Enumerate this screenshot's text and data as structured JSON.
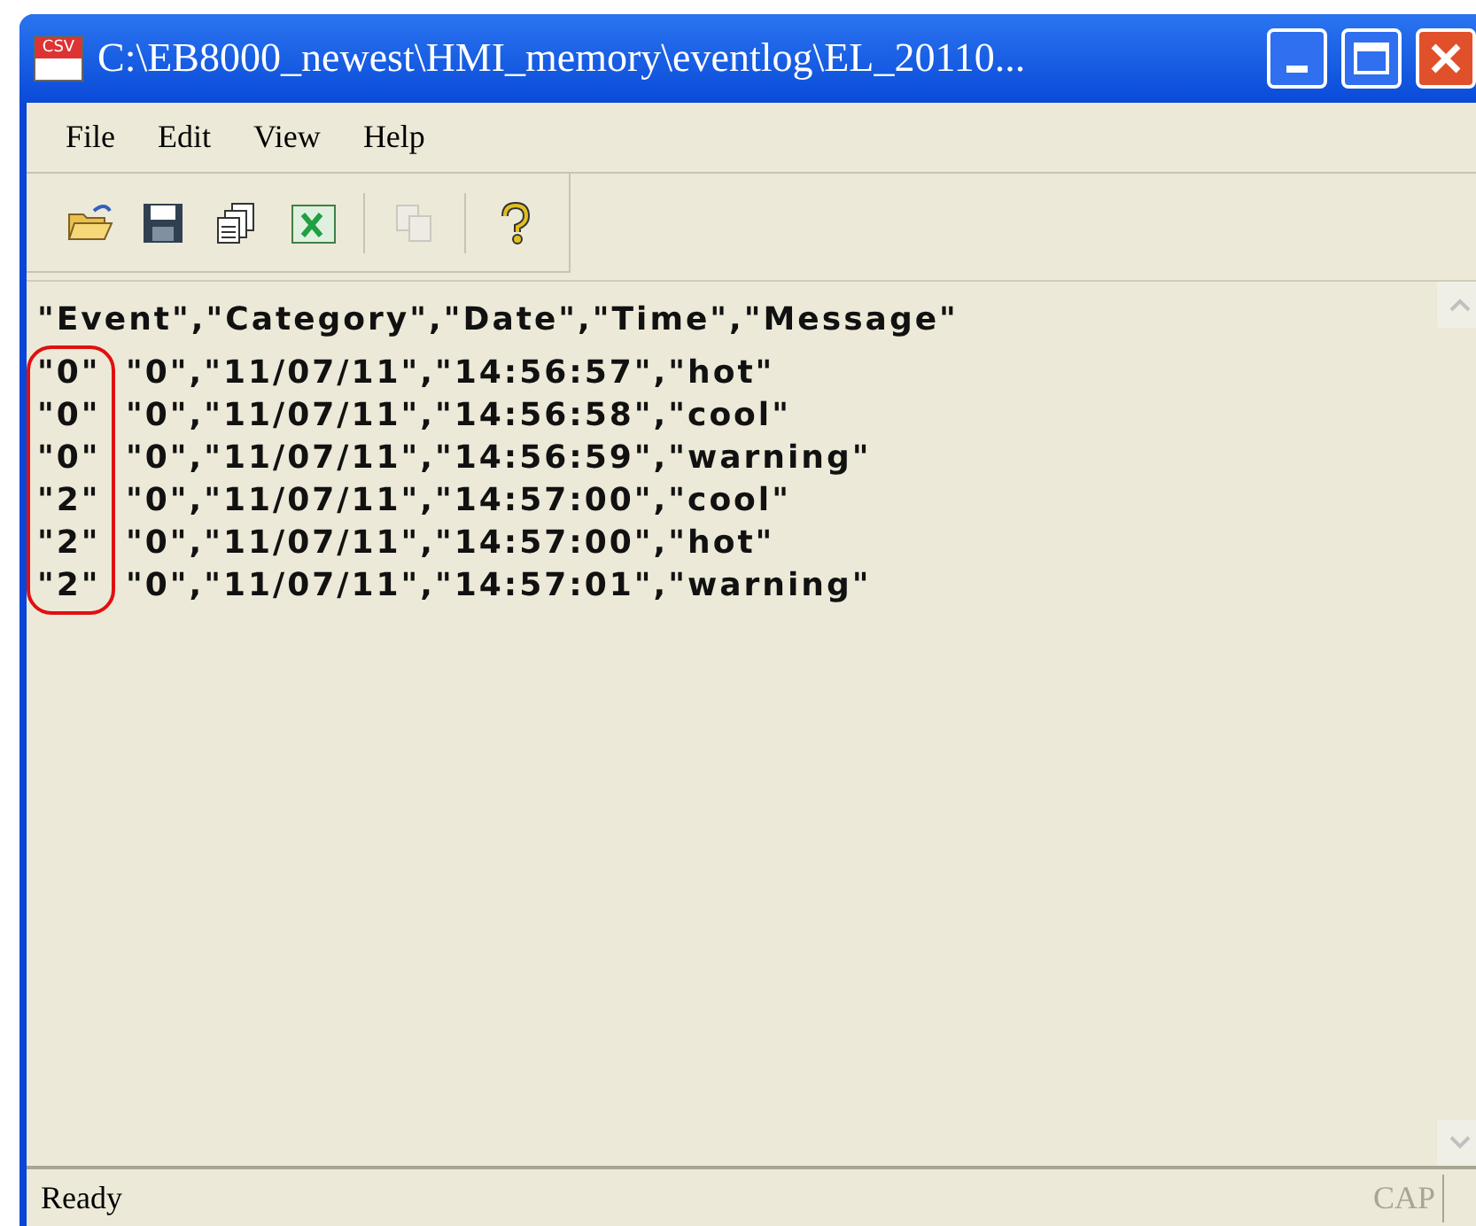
{
  "window": {
    "title": "C:\\EB8000_newest\\HMI_memory\\eventlog\\EL_20110...",
    "icon_label": "CSV"
  },
  "menu": [
    "File",
    "Edit",
    "View",
    "Help"
  ],
  "toolbar": [
    {
      "kind": "open"
    },
    {
      "kind": "save"
    },
    {
      "kind": "copy-pages"
    },
    {
      "kind": "excel"
    },
    {
      "kind": "separator"
    },
    {
      "kind": "paste",
      "disabled": true
    },
    {
      "kind": "separator"
    },
    {
      "kind": "help"
    }
  ],
  "document": {
    "header": "\"Event\",\"Category\",\"Date\",\"Time\",\"Message\"",
    "rows": [
      {
        "event": "\"0\"",
        "rest": "\"0\",\"11/07/11\",\"14:56:57\",\"hot\""
      },
      {
        "event": "\"0\"",
        "rest": "\"0\",\"11/07/11\",\"14:56:58\",\"cool\""
      },
      {
        "event": "\"0\"",
        "rest": "\"0\",\"11/07/11\",\"14:56:59\",\"warning\""
      },
      {
        "event": "\"2\"",
        "rest": "\"0\",\"11/07/11\",\"14:57:00\",\"cool\""
      },
      {
        "event": "\"2\"",
        "rest": "\"0\",\"11/07/11\",\"14:57:00\",\"hot\""
      },
      {
        "event": "\"2\"",
        "rest": "\"0\",\"11/07/11\",\"14:57:01\",\"warning\""
      }
    ]
  },
  "status_bar": {
    "text": "Ready",
    "indicator": {
      "label": "CAP",
      "on": false
    }
  }
}
